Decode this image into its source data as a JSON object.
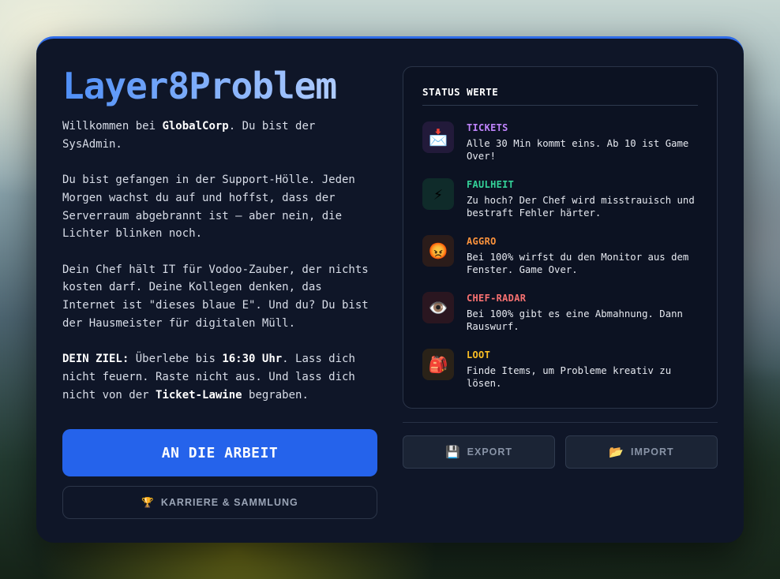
{
  "title": "Layer8Problem",
  "intro": {
    "p1_pre": "Willkommen bei ",
    "p1_bold": "GlobalCorp",
    "p1_post": ". Du bist der SysAdmin.",
    "p2": "Du bist gefangen in der Support-Hölle. Jeden Morgen wachst du auf und hoffst, dass der Serverraum abgebrannt ist – aber nein, die Lichter blinken noch.",
    "p3": "Dein Chef hält IT für Vodoo-Zauber, der nichts kosten darf. Deine Kollegen denken, das Internet ist \"dieses blaue E\". Und du? Du bist der Hausmeister für digitalen Müll.",
    "p4_bold1": "DEIN ZIEL:",
    "p4_mid1": " Überlebe bis ",
    "p4_bold2": "16:30 Uhr",
    "p4_mid2": ". Lass dich nicht feuern. Raste nicht aus. Und lass dich nicht von der ",
    "p4_bold3": "Ticket-Lawine",
    "p4_post": " begraben."
  },
  "buttons": {
    "start": "AN DIE ARBEIT",
    "career_icon": "🏆",
    "career": "KARRIERE & SAMMLUNG",
    "export_icon": "💾",
    "export": "EXPORT",
    "import_icon": "📂",
    "import": "IMPORT"
  },
  "status": {
    "heading": "STATUS WERTE",
    "items": [
      {
        "icon": "📩",
        "icon_name": "inbox-tray-icon",
        "name": "TICKETS",
        "color": "#c084fc",
        "bg": "#221a3a",
        "desc": "Alle 30 Min kommt eins. Ab 10 ist Game Over!"
      },
      {
        "icon": "⚡",
        "icon_name": "lightning-icon",
        "name": "FAULHEIT",
        "color": "#34d399",
        "bg": "#0f2b2a",
        "desc": "Zu hoch? Der Chef wird misstrauisch und bestraft Fehler härter."
      },
      {
        "icon": "😡",
        "icon_name": "angry-face-icon",
        "name": "AGGRO",
        "color": "#fb923c",
        "bg": "#2b1c1a",
        "desc": "Bei 100% wirfst du den Monitor aus dem Fenster. Game Over."
      },
      {
        "icon": "👁️",
        "icon_name": "eye-icon",
        "name": "CHEF-RADAR",
        "color": "#f87171",
        "bg": "#2a1620",
        "desc": "Bei 100% gibt es eine Abmahnung. Dann Rauswurf."
      },
      {
        "icon": "🎒",
        "icon_name": "backpack-icon",
        "name": "LOOT",
        "color": "#fbbf24",
        "bg": "#2a2218",
        "desc": "Finde Items, um Probleme kreativ zu lösen."
      }
    ]
  }
}
